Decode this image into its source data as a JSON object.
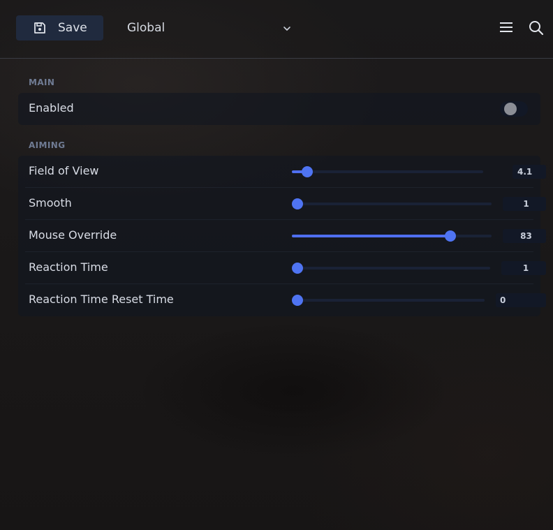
{
  "toolbar": {
    "save_label": "Save",
    "profile_value": "Global"
  },
  "sections": {
    "main": {
      "title": "MAIN",
      "enabled_label": "Enabled",
      "enabled_on": false
    },
    "aiming": {
      "title": "AIMING",
      "sliders": [
        {
          "label": "Field of View",
          "value": "4.1",
          "fraction": 0.055
        },
        {
          "label": "Smooth",
          "value": "1",
          "fraction": 0.0
        },
        {
          "label": "Mouse Override",
          "value": "83",
          "fraction": 0.81
        },
        {
          "label": "Reaction Time",
          "value": "1",
          "fraction": 0.0
        },
        {
          "label": "Reaction Time Reset Time",
          "value": "0",
          "fraction": 0.0
        }
      ]
    }
  },
  "colors": {
    "accent": "#4f74f2",
    "toggle_off": "#8b8e96"
  }
}
